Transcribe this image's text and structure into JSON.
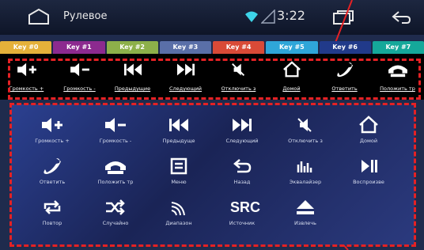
{
  "status_bar": {
    "title": "Рулевое",
    "time": "3:22"
  },
  "key_tabs": [
    {
      "label": "Key #0",
      "color": "#e5b13a"
    },
    {
      "label": "Key #1",
      "color": "#8c2a8f"
    },
    {
      "label": "Key #2",
      "color": "#8db04a"
    },
    {
      "label": "Key #3",
      "color": "#5a6fa8"
    },
    {
      "label": "Key #4",
      "color": "#d94a37"
    },
    {
      "label": "Key #5",
      "color": "#2fa6d9"
    },
    {
      "label": "Key #6",
      "color": "#213a8a"
    },
    {
      "label": "Key #7",
      "color": "#15a89a"
    }
  ],
  "top_row": [
    {
      "icon": "volume-up-icon",
      "label": "Громкость +"
    },
    {
      "icon": "volume-down-icon",
      "label": "Громкость -"
    },
    {
      "icon": "previous-track-icon",
      "label": "Предыдущие"
    },
    {
      "icon": "next-track-icon",
      "label": "Следующий"
    },
    {
      "icon": "mute-icon",
      "label": "Отключить з"
    },
    {
      "icon": "home-icon",
      "label": "Домой"
    },
    {
      "icon": "answer-call-icon",
      "label": "Ответить"
    },
    {
      "icon": "hang-up-icon",
      "label": "Положить тр"
    }
  ],
  "grid": [
    {
      "icon": "volume-up-icon",
      "label": "Громкость +"
    },
    {
      "icon": "volume-down-icon",
      "label": "Громкость -"
    },
    {
      "icon": "previous-track-icon",
      "label": "Предыдуще"
    },
    {
      "icon": "next-track-icon",
      "label": "Следующий"
    },
    {
      "icon": "mute-icon",
      "label": "Отключить з"
    },
    {
      "icon": "home-icon",
      "label": "Домой"
    },
    {
      "icon": "answer-call-icon",
      "label": "Ответить"
    },
    {
      "icon": "hang-up-icon",
      "label": "Положить тр"
    },
    {
      "icon": "menu-icon",
      "label": "Меню"
    },
    {
      "icon": "back-icon",
      "label": "Назад"
    },
    {
      "icon": "equalizer-icon",
      "label": "Эквалайзер"
    },
    {
      "icon": "play-pause-icon",
      "label": "Воспроизве"
    },
    {
      "icon": "repeat-icon",
      "label": "Повтор"
    },
    {
      "icon": "shuffle-icon",
      "label": "Случайно"
    },
    {
      "icon": "radio-band-icon",
      "label": "Диапазон"
    },
    {
      "icon": "source-icon",
      "label": "Источник",
      "glyph": "SRC"
    },
    {
      "icon": "eject-icon",
      "label": "Извлечь"
    }
  ]
}
